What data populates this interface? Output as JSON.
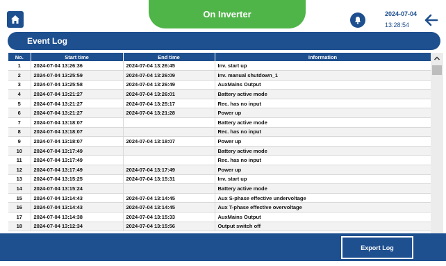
{
  "header": {
    "status_title": "On Inverter",
    "date": "2024-07-04",
    "time": "13:28:54",
    "icons": [
      "home-icon",
      "bell-icon",
      "back-arrow-icon"
    ],
    "colors": {
      "primary": "#1e4f8f",
      "status_green": "#4fb548"
    }
  },
  "page": {
    "title": "Event Log"
  },
  "table": {
    "columns": [
      "No.",
      "Start time",
      "End time",
      "Information"
    ],
    "rows": [
      [
        "1",
        "2024-07-04 13:26:36",
        "2024-07-04 13:26:45",
        "Inv. start up"
      ],
      [
        "2",
        "2024-07-04 13:25:59",
        "2024-07-04 13:26:09",
        "Inv. manual shutdown_1"
      ],
      [
        "3",
        "2024-07-04 13:25:58",
        "2024-07-04 13:26:49",
        "AuxMains Output"
      ],
      [
        "4",
        "2024-07-04 13:21:27",
        "2024-07-04 13:26:01",
        "Battery active mode"
      ],
      [
        "5",
        "2024-07-04 13:21:27",
        "2024-07-04 13:25:17",
        "Rec. has no input"
      ],
      [
        "6",
        "2024-07-04 13:21:27",
        "2024-07-04 13:21:28",
        "Power up"
      ],
      [
        "7",
        "2024-07-04 13:18:07",
        "",
        "Battery active mode"
      ],
      [
        "8",
        "2024-07-04 13:18:07",
        "",
        "Rec. has no input"
      ],
      [
        "9",
        "2024-07-04 13:18:07",
        "2024-07-04 13:18:07",
        "Power up"
      ],
      [
        "10",
        "2024-07-04 13:17:49",
        "",
        "Battery active mode"
      ],
      [
        "11",
        "2024-07-04 13:17:49",
        "",
        "Rec. has no input"
      ],
      [
        "12",
        "2024-07-04 13:17:49",
        "2024-07-04 13:17:49",
        "Power up"
      ],
      [
        "13",
        "2024-07-04 13:15:25",
        "2024-07-04 13:15:31",
        "Inv. start up"
      ],
      [
        "14",
        "2024-07-04 13:15:24",
        "",
        "Battery active mode"
      ],
      [
        "15",
        "2024-07-04 13:14:43",
        "2024-07-04 13:14:45",
        "Aux S-phase effective undervoltage"
      ],
      [
        "16",
        "2024-07-04 13:14:43",
        "2024-07-04 13:14:45",
        "Aux T-phase effective overvoltage"
      ],
      [
        "17",
        "2024-07-04 13:14:38",
        "2024-07-04 13:15:33",
        "AuxMains Output"
      ],
      [
        "18",
        "2024-07-04 13:12:34",
        "2024-07-04 13:15:56",
        "Output switch off"
      ]
    ]
  },
  "footer": {
    "export_label": "Export Log"
  }
}
